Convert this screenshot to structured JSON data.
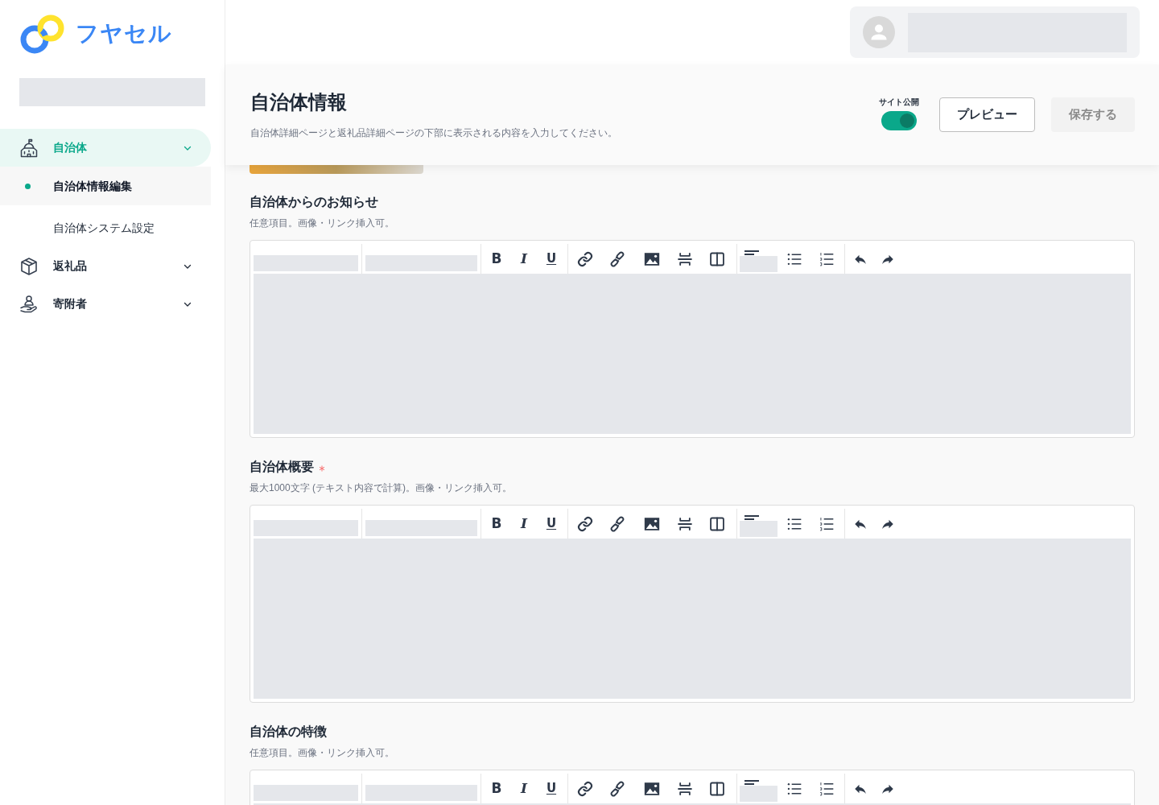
{
  "logo": {
    "text": "フヤセル"
  },
  "sidebar": {
    "nav": [
      {
        "label": "自治体",
        "selected": true,
        "children": [
          {
            "label": "自治体情報編集",
            "selected": true
          },
          {
            "label": "自治体システム設定",
            "selected": false
          }
        ]
      },
      {
        "label": "返礼品",
        "selected": false
      },
      {
        "label": "寄附者",
        "selected": false
      }
    ]
  },
  "page_header": {
    "title": "自治体情報",
    "description": "自治体詳細ページと返礼品詳細ページの下部に表示される内容を入力してください。",
    "publish_toggle": {
      "label": "サイト公開",
      "on": true
    },
    "buttons": [
      {
        "label": "プレビュー",
        "kind": "secondary",
        "disabled": false
      },
      {
        "label": "保存する",
        "kind": "primary",
        "disabled": true
      }
    ]
  },
  "sections": [
    {
      "title": "自治体からのお知らせ",
      "required": false,
      "hint": "任意項目。画像・リンク挿入可。",
      "toolbar": {
        "format_buttons": [
          {
            "kind": "bold",
            "label": "B"
          },
          {
            "kind": "italic",
            "label": "I"
          },
          {
            "kind": "underline",
            "label": "U"
          }
        ]
      }
    },
    {
      "title": "自治体概要",
      "required": true,
      "hint": "最大1000文字 (テキスト内容で計算)。画像・リンク挿入可。",
      "toolbar": {
        "format_buttons": [
          {
            "kind": "bold",
            "label": "B"
          },
          {
            "kind": "italic",
            "label": "I"
          },
          {
            "kind": "underline",
            "label": "U"
          }
        ]
      }
    },
    {
      "title": "自治体の特徴",
      "required": false,
      "hint": "任意項目。画像・リンク挿入可。",
      "toolbar": {
        "format_buttons": [
          {
            "kind": "bold",
            "label": "B"
          },
          {
            "kind": "italic",
            "label": "I"
          },
          {
            "kind": "underline",
            "label": "U"
          }
        ]
      }
    }
  ]
}
